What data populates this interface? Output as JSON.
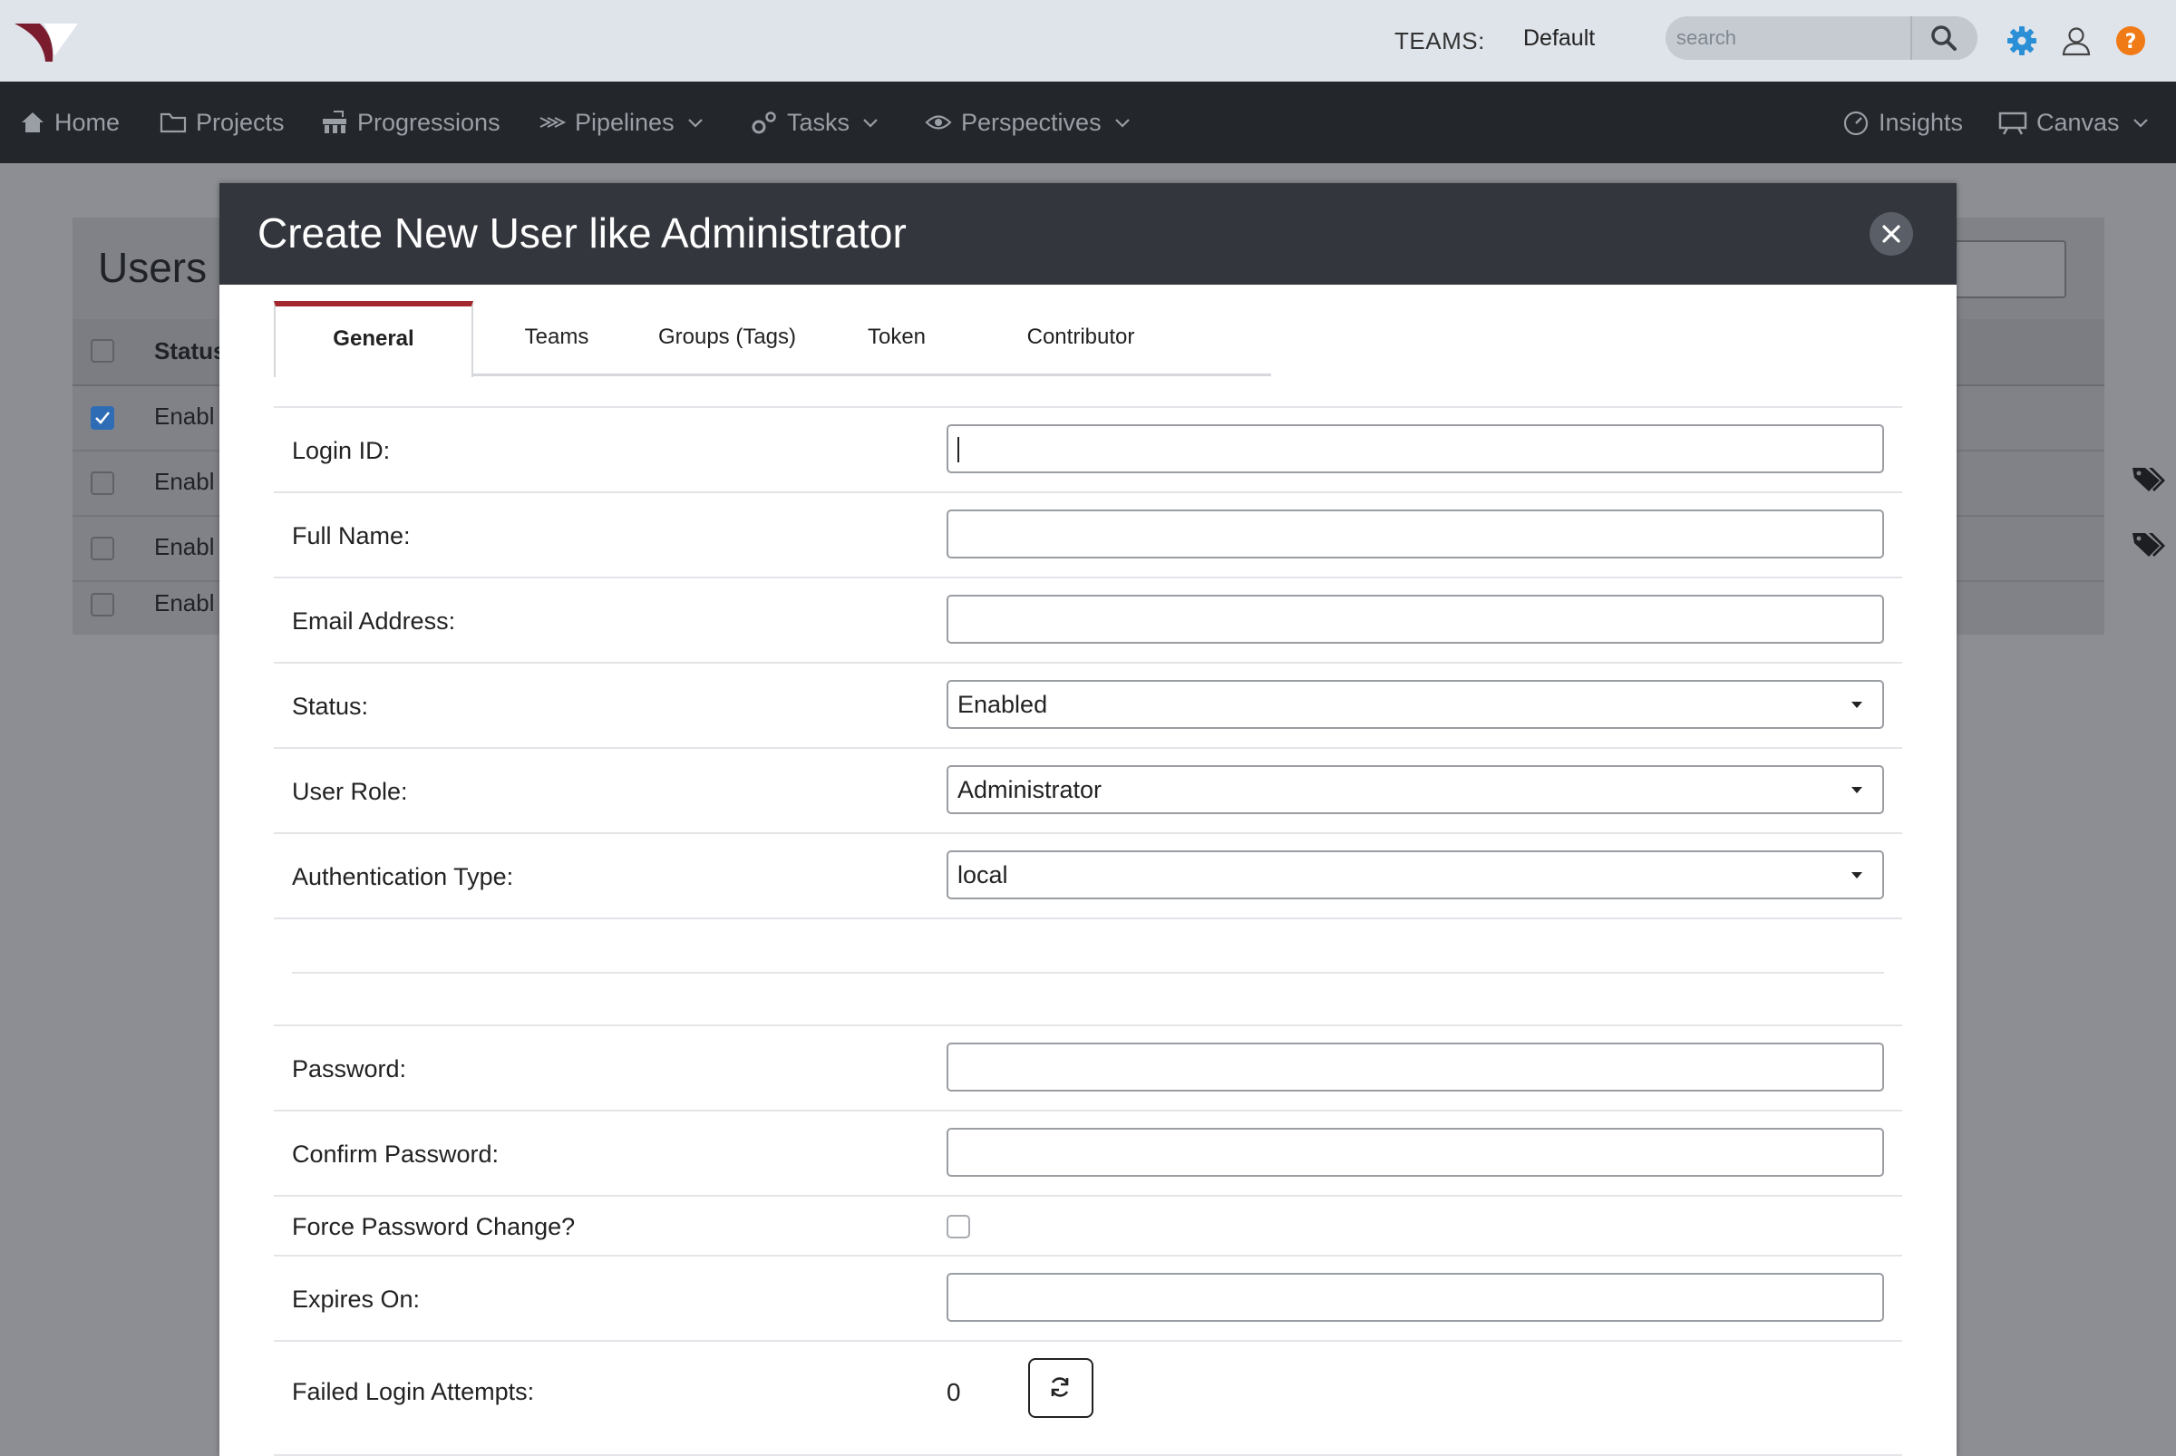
{
  "topbar": {
    "teams_label": "TEAMS:",
    "teams_value": "Default",
    "search_placeholder": "search"
  },
  "nav": {
    "items": [
      "Home",
      "Projects",
      "Progressions",
      "Pipelines",
      "Tasks",
      "Perspectives",
      "Insights",
      "Canvas"
    ]
  },
  "background": {
    "title": "Users",
    "column_status": "Status",
    "rows": [
      "Enabl",
      "Enabl",
      "Enabl",
      "Enabl"
    ]
  },
  "modal": {
    "title": "Create New User like Administrator",
    "tabs": [
      "General",
      "Teams",
      "Groups (Tags)",
      "Token",
      "Contributor"
    ],
    "fields": {
      "login_id": "Login ID:",
      "full_name": "Full Name:",
      "email": "Email Address:",
      "status": "Status:",
      "status_value": "Enabled",
      "user_role": "User Role:",
      "user_role_value": "Administrator",
      "auth_type": "Authentication Type:",
      "auth_type_value": "local",
      "password": "Password:",
      "confirm_password": "Confirm Password:",
      "force_change": "Force Password Change?",
      "expires_on": "Expires On:",
      "failed_attempts": "Failed Login Attempts:",
      "failed_attempts_value": "0"
    }
  },
  "colors": {
    "topbar": "#dfe3ea",
    "navbar": "#23262b",
    "modal_header": "#33363d",
    "active_tab_accent": "#a3272f",
    "gear": "#2b8fd6",
    "help": "#f07b16"
  }
}
